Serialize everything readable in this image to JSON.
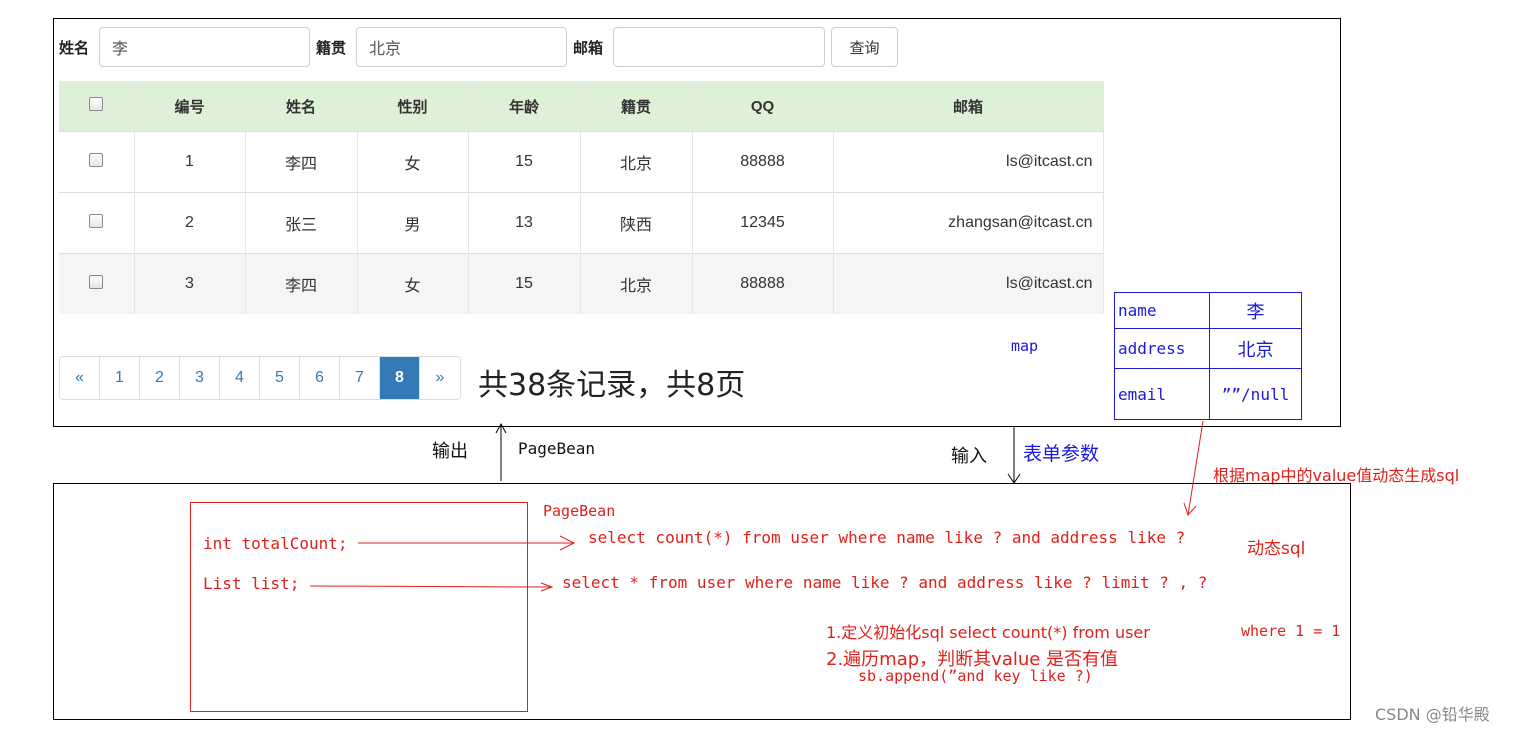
{
  "search": {
    "name_label": "姓名",
    "name_value": "李",
    "address_label": "籍贯",
    "address_value": "北京",
    "email_label": "邮箱",
    "email_value": "",
    "query_button": "查询"
  },
  "table": {
    "headers": [
      "编号",
      "姓名",
      "性别",
      "年龄",
      "籍贯",
      "QQ",
      "邮箱"
    ],
    "rows": [
      {
        "id": "1",
        "name": "李四",
        "gender": "女",
        "age": "15",
        "address": "北京",
        "qq": "88888",
        "email": "ls@itcast.cn"
      },
      {
        "id": "2",
        "name": "张三",
        "gender": "男",
        "age": "13",
        "address": "陕西",
        "qq": "12345",
        "email": "zhangsan@itcast.cn"
      },
      {
        "id": "3",
        "name": "李四",
        "gender": "女",
        "age": "15",
        "address": "北京",
        "qq": "88888",
        "email": "ls@itcast.cn"
      }
    ]
  },
  "pagination": {
    "prev": "«",
    "pages": [
      "1",
      "2",
      "3",
      "4",
      "5",
      "6",
      "7",
      "8"
    ],
    "active": "8",
    "next": "»",
    "total_text": "共38条记录，共8页"
  },
  "map": {
    "label": "map",
    "rows": [
      {
        "key": "name",
        "value": "李"
      },
      {
        "key": "address",
        "value": "北京"
      },
      {
        "key": "email",
        "value": "””/null"
      }
    ]
  },
  "flow": {
    "output_label": "输出",
    "output_type": "PageBean",
    "input_label": "输入",
    "input_type": "表单参数",
    "map_note": "根据map中的value值动态生成sql"
  },
  "pagebean": {
    "title": "PageBean",
    "field1": "int totalCount;",
    "field2": "List list;",
    "sql1": "select count(*) from user where name like ? and address like ?",
    "sql2": "select * from user where name like ? and address like ? limit ? , ?",
    "dynamic_label": "动态sql",
    "step1a": "1.定义初始化sql select count(*) from user",
    "step1b": "where 1 = 1",
    "step2": "2.遍历map，判断其value 是否有值",
    "step3": "sb.append(”and  key like ?)"
  },
  "watermark": "CSDN @铅华殿",
  "colors": {
    "annotation_red": "#e0201b",
    "annotation_blue": "#1a1adb",
    "header_green": "#dff0d8",
    "active_page": "#337ab7"
  }
}
